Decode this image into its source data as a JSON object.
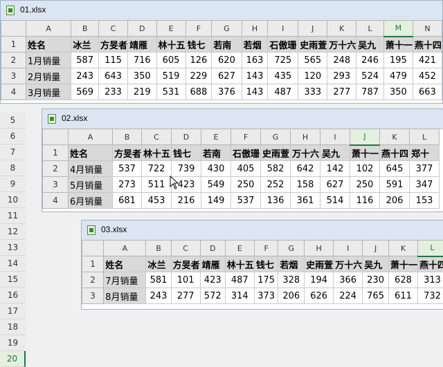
{
  "window1": {
    "title": "01.xlsx",
    "cols": [
      "A",
      "B",
      "C",
      "D",
      "E",
      "F",
      "G",
      "H",
      "I",
      "J",
      "K",
      "L",
      "M",
      "N"
    ],
    "selected_col": "M",
    "headers": [
      "姓名",
      "冰兰",
      "方旻者",
      "靖雁",
      "林十五",
      "钱七",
      "若南",
      "若烟",
      "石傲珊",
      "史雨萱",
      "万十六",
      "吴九",
      "萧十一",
      "燕十四"
    ],
    "rows": [
      {
        "n": "2",
        "label": "1月销量",
        "values": [
          "587",
          "115",
          "716",
          "605",
          "126",
          "620",
          "163",
          "725",
          "565",
          "248",
          "246",
          "195",
          "421"
        ]
      },
      {
        "n": "3",
        "label": "2月销量",
        "values": [
          "243",
          "643",
          "350",
          "519",
          "229",
          "627",
          "143",
          "435",
          "120",
          "293",
          "524",
          "479",
          "452"
        ]
      },
      {
        "n": "4",
        "label": "3月销量",
        "values": [
          "569",
          "233",
          "219",
          "531",
          "688",
          "376",
          "143",
          "487",
          "333",
          "277",
          "787",
          "350",
          "663"
        ]
      }
    ]
  },
  "gutter_rows": [
    "5",
    "6",
    "7",
    "8",
    "9",
    "10",
    "11",
    "12",
    "13",
    "14",
    "15",
    "16",
    "17",
    "18",
    "19",
    "20"
  ],
  "gutter_selected": "20",
  "window2": {
    "title": "02.xlsx",
    "cols": [
      "A",
      "B",
      "C",
      "D",
      "E",
      "F",
      "G",
      "H",
      "I",
      "J",
      "K",
      "L"
    ],
    "selected_col": "J",
    "headers": [
      "姓名",
      "方旻者",
      "林十五",
      "钱七",
      "若南",
      "石傲珊",
      "史雨萱",
      "万十六",
      "吴九",
      "萧十一",
      "燕十四",
      "郑十"
    ],
    "rows": [
      {
        "n": "2",
        "label": "4月销量",
        "values": [
          "537",
          "722",
          "739",
          "430",
          "405",
          "582",
          "642",
          "142",
          "102",
          "645",
          "377"
        ]
      },
      {
        "n": "3",
        "label": "5月销量",
        "values": [
          "273",
          "511",
          "423",
          "549",
          "250",
          "252",
          "158",
          "627",
          "250",
          "591",
          "347"
        ]
      },
      {
        "n": "4",
        "label": "6月销量",
        "values": [
          "681",
          "453",
          "216",
          "149",
          "537",
          "136",
          "361",
          "514",
          "116",
          "206",
          "153"
        ]
      }
    ]
  },
  "window3": {
    "title": "03.xlsx",
    "cols": [
      "A",
      "B",
      "C",
      "D",
      "E",
      "F",
      "G",
      "H",
      "I",
      "J",
      "K",
      "L"
    ],
    "selected_col": "L",
    "headers": [
      "姓名",
      "冰兰",
      "方旻者",
      "靖雁",
      "林十五",
      "钱七",
      "若烟",
      "史雨萱",
      "万十六",
      "吴九",
      "萧十一",
      "燕十四"
    ],
    "rows": [
      {
        "n": "2",
        "label": "7月销量",
        "values": [
          "581",
          "101",
          "423",
          "487",
          "175",
          "328",
          "194",
          "366",
          "230",
          "628",
          "313"
        ]
      },
      {
        "n": "3",
        "label": "8月销量",
        "values": [
          "243",
          "277",
          "572",
          "314",
          "373",
          "206",
          "626",
          "224",
          "765",
          "611",
          "732"
        ]
      }
    ]
  }
}
